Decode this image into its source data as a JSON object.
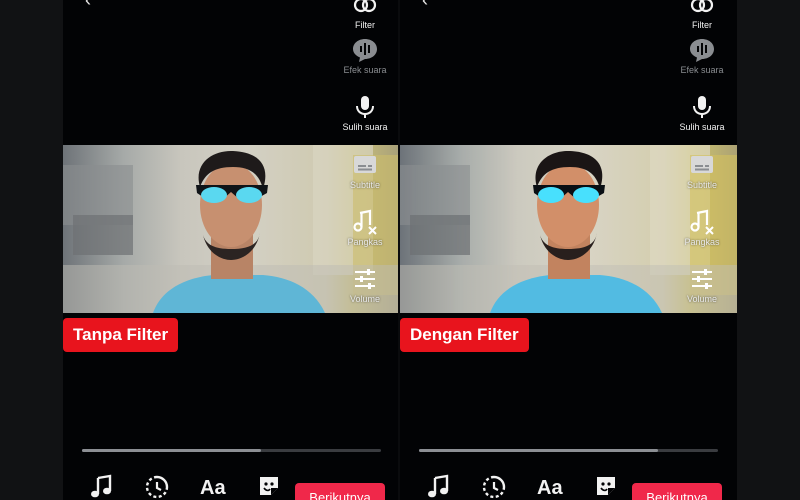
{
  "left_panel": {
    "caption": "Tanpa Filter",
    "tools": {
      "filter": "Filter",
      "sound_effect": "Efek suara",
      "voiceover": "Sulih suara",
      "subtitle": "Subtitle",
      "trim": "Pangkas",
      "volume": "Volume"
    },
    "text_tool": "Aa",
    "next_button": "Berikutnya",
    "progress": 0.6
  },
  "right_panel": {
    "caption": "Dengan Filter",
    "tools": {
      "filter": "Filter",
      "sound_effect": "Efek suara",
      "voiceover": "Sulih suara",
      "subtitle": "Subtitle",
      "trim": "Pangkas",
      "volume": "Volume"
    },
    "text_tool": "Aa",
    "next_button": "Berikutnya",
    "progress": 0.8
  },
  "colors": {
    "caption_background": "#e8141d",
    "next_button": "#f0284a",
    "panel_background": "#020305",
    "sunglasses_lens": "#5ad8f0",
    "shirt": "#5fb6d6"
  },
  "icons": [
    "back-arrow-icon",
    "filter-icon",
    "sound-effect-icon",
    "microphone-icon",
    "subtitle-icon",
    "trim-icon",
    "volume-sliders-icon",
    "music-note-icon",
    "timer-icon",
    "sticker-icon"
  ]
}
